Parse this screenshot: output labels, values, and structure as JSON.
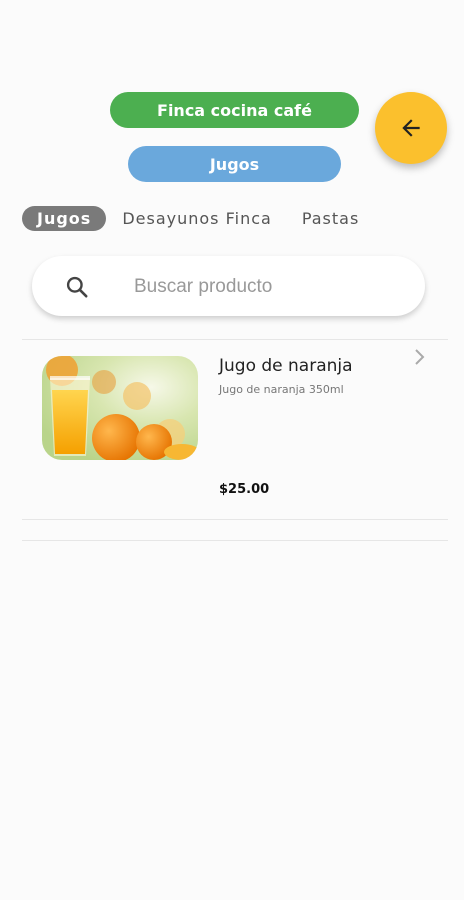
{
  "header": {
    "store_label": "Finca cocina café",
    "category_label": "Jugos",
    "back_icon": "arrow-left-icon",
    "colors": {
      "store": "#4caf50",
      "category": "#6aa8dc",
      "fab": "#fbc02d"
    }
  },
  "tabs": [
    {
      "label": "Jugos",
      "active": true
    },
    {
      "label": "Desayunos Finca",
      "active": false
    },
    {
      "label": "Pastas",
      "active": false
    }
  ],
  "search": {
    "placeholder": "Buscar producto",
    "value": "",
    "icon": "search-icon"
  },
  "products": [
    {
      "name": "Jugo de naranja",
      "description": "Jugo de naranja 350ml",
      "price": "$25.00",
      "image": "orange-juice-photo"
    }
  ]
}
